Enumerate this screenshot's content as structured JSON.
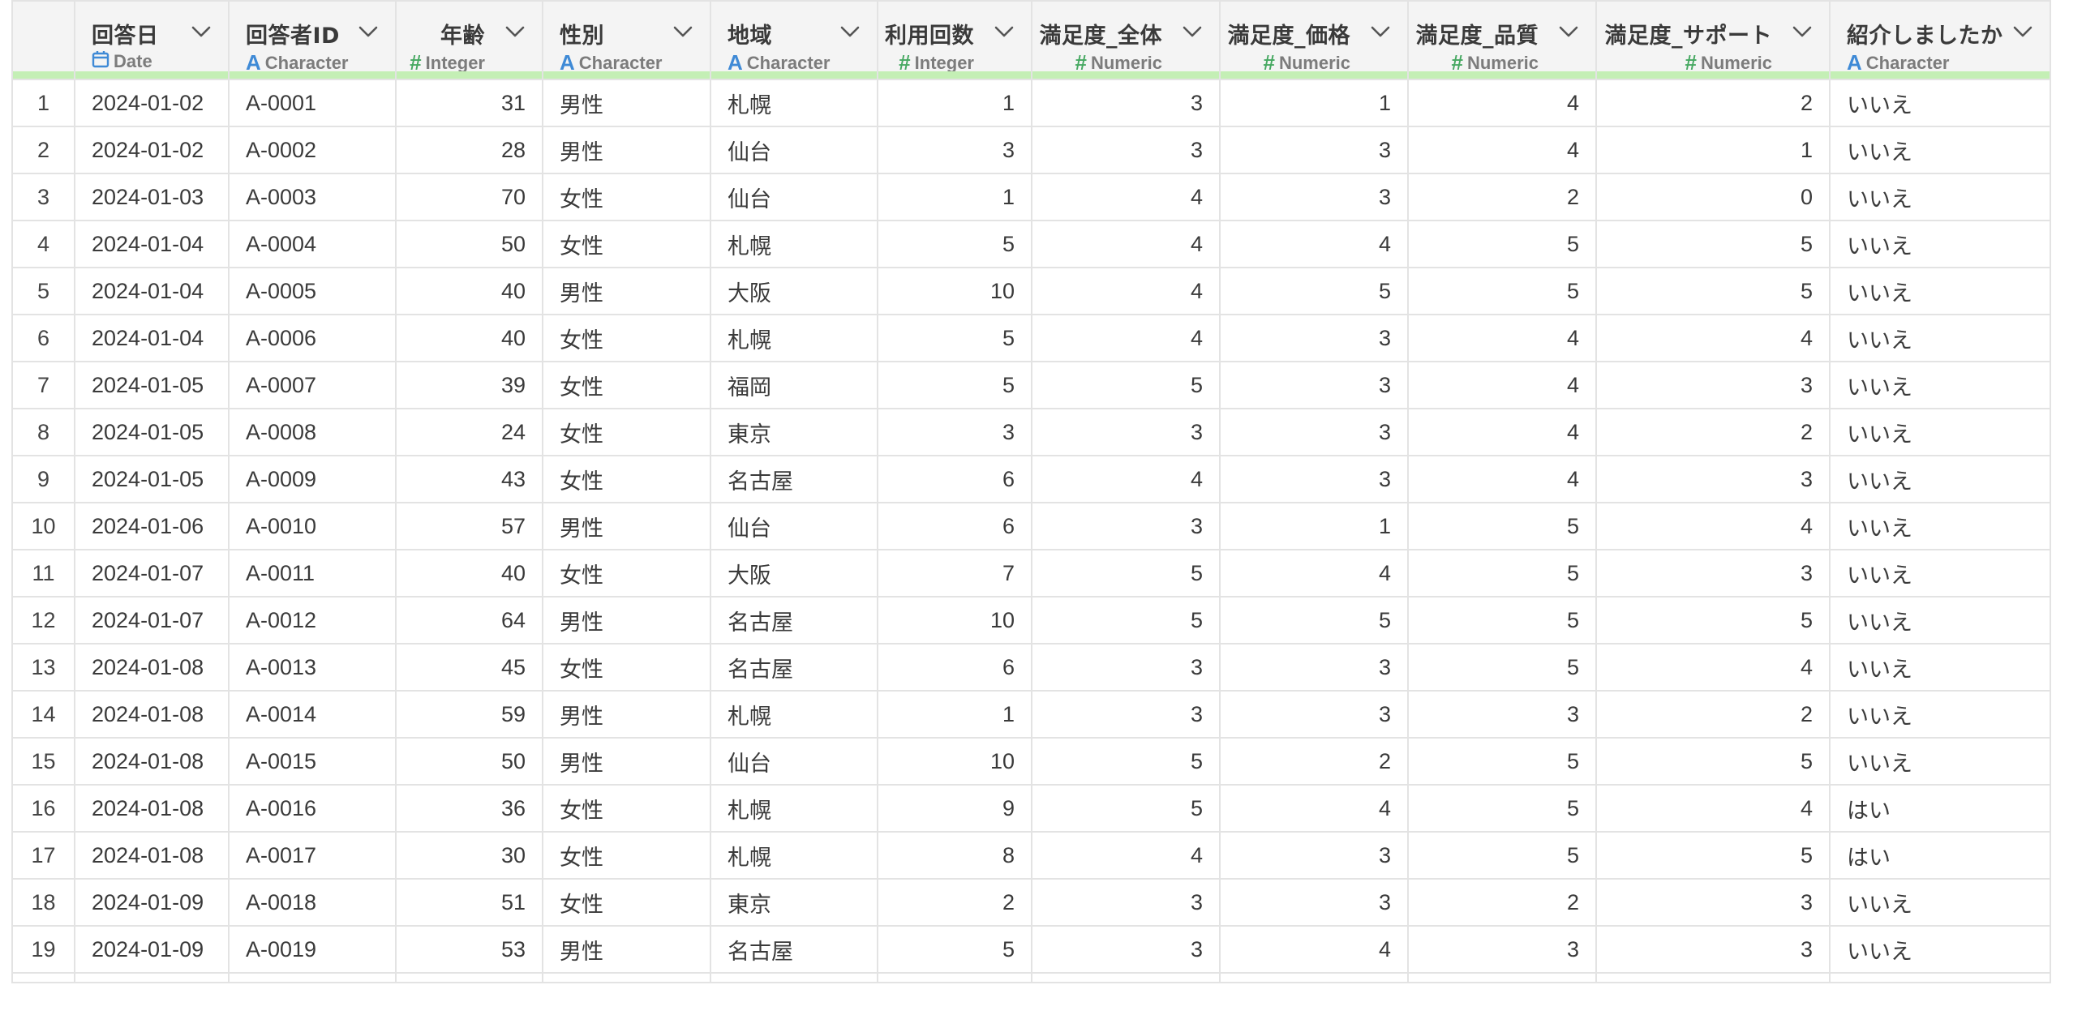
{
  "columns": [
    {
      "name": "回答日",
      "type": "Date",
      "icon": "calendar-icon",
      "align": "left"
    },
    {
      "name": "回答者ID",
      "type": "Character",
      "icon": "character-type-icon",
      "align": "left"
    },
    {
      "name": "年齢",
      "type": "Integer",
      "icon": "number-type-icon",
      "align": "right"
    },
    {
      "name": "性別",
      "type": "Character",
      "icon": "character-type-icon",
      "align": "left"
    },
    {
      "name": "地域",
      "type": "Character",
      "icon": "character-type-icon",
      "align": "left"
    },
    {
      "name": "利用回数",
      "type": "Integer",
      "icon": "number-type-icon",
      "align": "right"
    },
    {
      "name": "満足度_全体",
      "type": "Numeric",
      "icon": "number-type-icon",
      "align": "right"
    },
    {
      "name": "満足度_価格",
      "type": "Numeric",
      "icon": "number-type-icon",
      "align": "right"
    },
    {
      "name": "満足度_品質",
      "type": "Numeric",
      "icon": "number-type-icon",
      "align": "right"
    },
    {
      "name": "満足度_サポート",
      "type": "Numeric",
      "icon": "number-type-icon",
      "align": "right"
    },
    {
      "name": "紹介しましたか",
      "type": "Character",
      "icon": "character-type-icon",
      "align": "left"
    }
  ],
  "rows": [
    {
      "n": "1",
      "cells": [
        "2024-01-02",
        "A-0001",
        "31",
        "男性",
        "札幌",
        "1",
        "3",
        "1",
        "4",
        "2",
        "いいえ"
      ]
    },
    {
      "n": "2",
      "cells": [
        "2024-01-02",
        "A-0002",
        "28",
        "男性",
        "仙台",
        "3",
        "3",
        "3",
        "4",
        "1",
        "いいえ"
      ]
    },
    {
      "n": "3",
      "cells": [
        "2024-01-03",
        "A-0003",
        "70",
        "女性",
        "仙台",
        "1",
        "4",
        "3",
        "2",
        "0",
        "いいえ"
      ]
    },
    {
      "n": "4",
      "cells": [
        "2024-01-04",
        "A-0004",
        "50",
        "女性",
        "札幌",
        "5",
        "4",
        "4",
        "5",
        "5",
        "いいえ"
      ]
    },
    {
      "n": "5",
      "cells": [
        "2024-01-04",
        "A-0005",
        "40",
        "男性",
        "大阪",
        "10",
        "4",
        "5",
        "5",
        "5",
        "いいえ"
      ]
    },
    {
      "n": "6",
      "cells": [
        "2024-01-04",
        "A-0006",
        "40",
        "女性",
        "札幌",
        "5",
        "4",
        "3",
        "4",
        "4",
        "いいえ"
      ]
    },
    {
      "n": "7",
      "cells": [
        "2024-01-05",
        "A-0007",
        "39",
        "女性",
        "福岡",
        "5",
        "5",
        "3",
        "4",
        "3",
        "いいえ"
      ]
    },
    {
      "n": "8",
      "cells": [
        "2024-01-05",
        "A-0008",
        "24",
        "女性",
        "東京",
        "3",
        "3",
        "3",
        "4",
        "2",
        "いいえ"
      ]
    },
    {
      "n": "9",
      "cells": [
        "2024-01-05",
        "A-0009",
        "43",
        "女性",
        "名古屋",
        "6",
        "4",
        "3",
        "4",
        "3",
        "いいえ"
      ]
    },
    {
      "n": "10",
      "cells": [
        "2024-01-06",
        "A-0010",
        "57",
        "男性",
        "仙台",
        "6",
        "3",
        "1",
        "5",
        "4",
        "いいえ"
      ]
    },
    {
      "n": "11",
      "cells": [
        "2024-01-07",
        "A-0011",
        "40",
        "女性",
        "大阪",
        "7",
        "5",
        "4",
        "5",
        "3",
        "いいえ"
      ]
    },
    {
      "n": "12",
      "cells": [
        "2024-01-07",
        "A-0012",
        "64",
        "男性",
        "名古屋",
        "10",
        "5",
        "5",
        "5",
        "5",
        "いいえ"
      ]
    },
    {
      "n": "13",
      "cells": [
        "2024-01-08",
        "A-0013",
        "45",
        "女性",
        "名古屋",
        "6",
        "3",
        "3",
        "5",
        "4",
        "いいえ"
      ]
    },
    {
      "n": "14",
      "cells": [
        "2024-01-08",
        "A-0014",
        "59",
        "男性",
        "札幌",
        "1",
        "3",
        "3",
        "3",
        "2",
        "いいえ"
      ]
    },
    {
      "n": "15",
      "cells": [
        "2024-01-08",
        "A-0015",
        "50",
        "男性",
        "仙台",
        "10",
        "5",
        "2",
        "5",
        "5",
        "いいえ"
      ]
    },
    {
      "n": "16",
      "cells": [
        "2024-01-08",
        "A-0016",
        "36",
        "女性",
        "札幌",
        "9",
        "5",
        "4",
        "5",
        "4",
        "はい"
      ]
    },
    {
      "n": "17",
      "cells": [
        "2024-01-08",
        "A-0017",
        "30",
        "女性",
        "札幌",
        "8",
        "4",
        "3",
        "5",
        "5",
        "はい"
      ]
    },
    {
      "n": "18",
      "cells": [
        "2024-01-09",
        "A-0018",
        "51",
        "女性",
        "東京",
        "2",
        "3",
        "3",
        "2",
        "3",
        "いいえ"
      ]
    },
    {
      "n": "19",
      "cells": [
        "2024-01-09",
        "A-0019",
        "53",
        "男性",
        "名古屋",
        "5",
        "3",
        "4",
        "3",
        "3",
        "いいえ"
      ]
    }
  ],
  "colors": {
    "header_bg": "#f4f4f4",
    "grid_line": "#e3e3e3",
    "quality_bar": "#c4efb5",
    "character_icon": "#3f8ad6",
    "number_icon": "#46a861",
    "date_icon": "#3f8ad6"
  }
}
